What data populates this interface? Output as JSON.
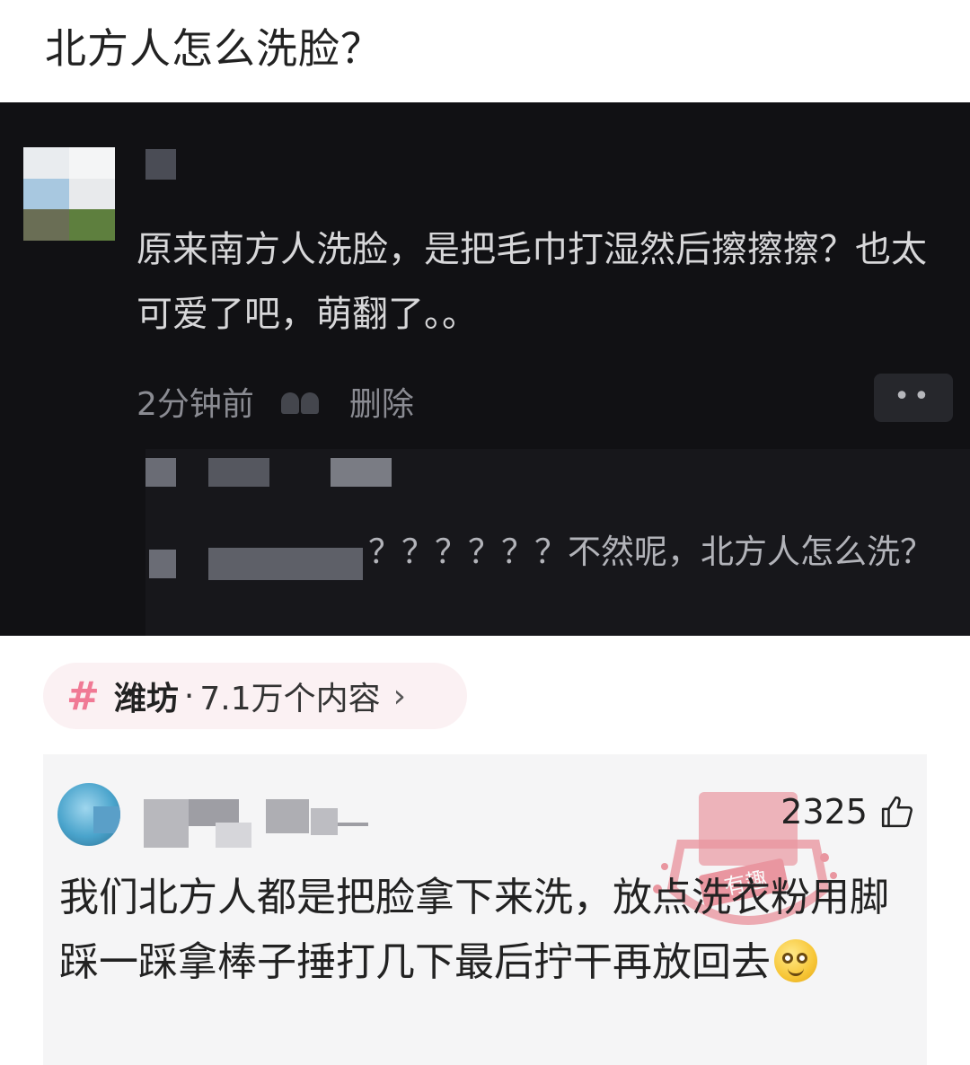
{
  "question": "北方人怎么洗脸？",
  "dark_comment": {
    "text": "原来南方人洗脸，是把毛巾打湿然后擦擦擦？也太可爱了吧，萌翻了。。",
    "time": "2分钟前",
    "delete_label": "删除",
    "more_label": "••"
  },
  "reply": {
    "text": "？？？？？？不然呢，北方人怎么洗？"
  },
  "topic": {
    "hash": "#",
    "place": "潍坊",
    "separator": "·",
    "count": "7.1万个内容",
    "chevron": "›"
  },
  "bottom_comment": {
    "likes": "2325",
    "text": "我们北方人都是把脸拿下来洗，放点洗衣粉用脚踩一踩拿棒子捶打几下最后拧干再放回去",
    "watermark": "有趣"
  },
  "colors": {
    "dark_bg": "#111114",
    "topic_hash": "#f07a95",
    "stamp": "#e04a5a"
  }
}
